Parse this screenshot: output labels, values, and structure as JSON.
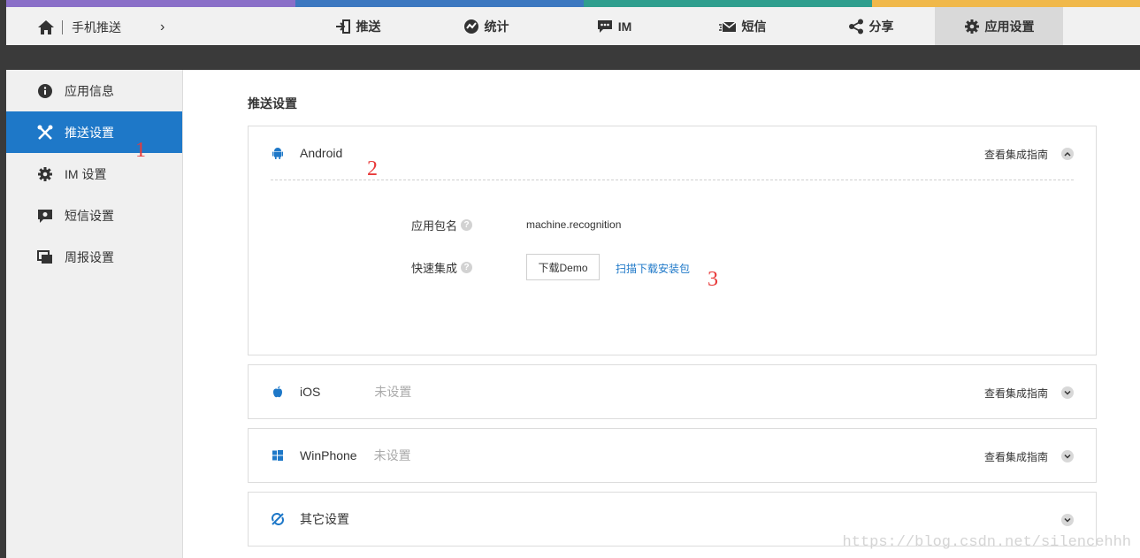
{
  "topbar": {
    "stripe_colors": [
      "#8a6fc8",
      "#3c78c0",
      "#2f9e8e",
      "#f0b84a"
    ],
    "breadcrumb": {
      "label": "手机推送",
      "arrow": "›"
    },
    "nav": [
      {
        "label": "推送",
        "icon": "push-icon"
      },
      {
        "label": "统计",
        "icon": "stats-icon"
      },
      {
        "label": "IM",
        "icon": "chat-icon"
      },
      {
        "label": "短信",
        "icon": "sms-icon"
      },
      {
        "label": "分享",
        "icon": "share-icon"
      },
      {
        "label": "应用设置",
        "icon": "gear-icon",
        "active": true
      }
    ]
  },
  "sidebar": {
    "items": [
      {
        "label": "应用信息",
        "icon": "info-icon"
      },
      {
        "label": "推送设置",
        "icon": "tools-icon",
        "active": true
      },
      {
        "label": "IM 设置",
        "icon": "gear-icon"
      },
      {
        "label": "短信设置",
        "icon": "sms-settings-icon"
      },
      {
        "label": "周报设置",
        "icon": "report-icon"
      }
    ]
  },
  "main": {
    "title": "推送设置",
    "android": {
      "name": "Android",
      "guide": "查看集成指南",
      "package_label": "应用包名",
      "package_value": "machine.recognition",
      "quick_label": "快速集成",
      "download_button": "下载Demo",
      "scan_link": "扫描下载安装包"
    },
    "ios": {
      "name": "iOS",
      "status": "未设置",
      "guide": "查看集成指南"
    },
    "winphone": {
      "name": "WinPhone",
      "status": "未设置",
      "guide": "查看集成指南"
    },
    "other": {
      "name": "其它设置"
    }
  },
  "annotations": [
    "1",
    "2",
    "3"
  ],
  "watermark": "https://blog.csdn.net/silencehhh",
  "colors": {
    "accent": "#1e78c8",
    "annotation": "#e83a3a"
  }
}
